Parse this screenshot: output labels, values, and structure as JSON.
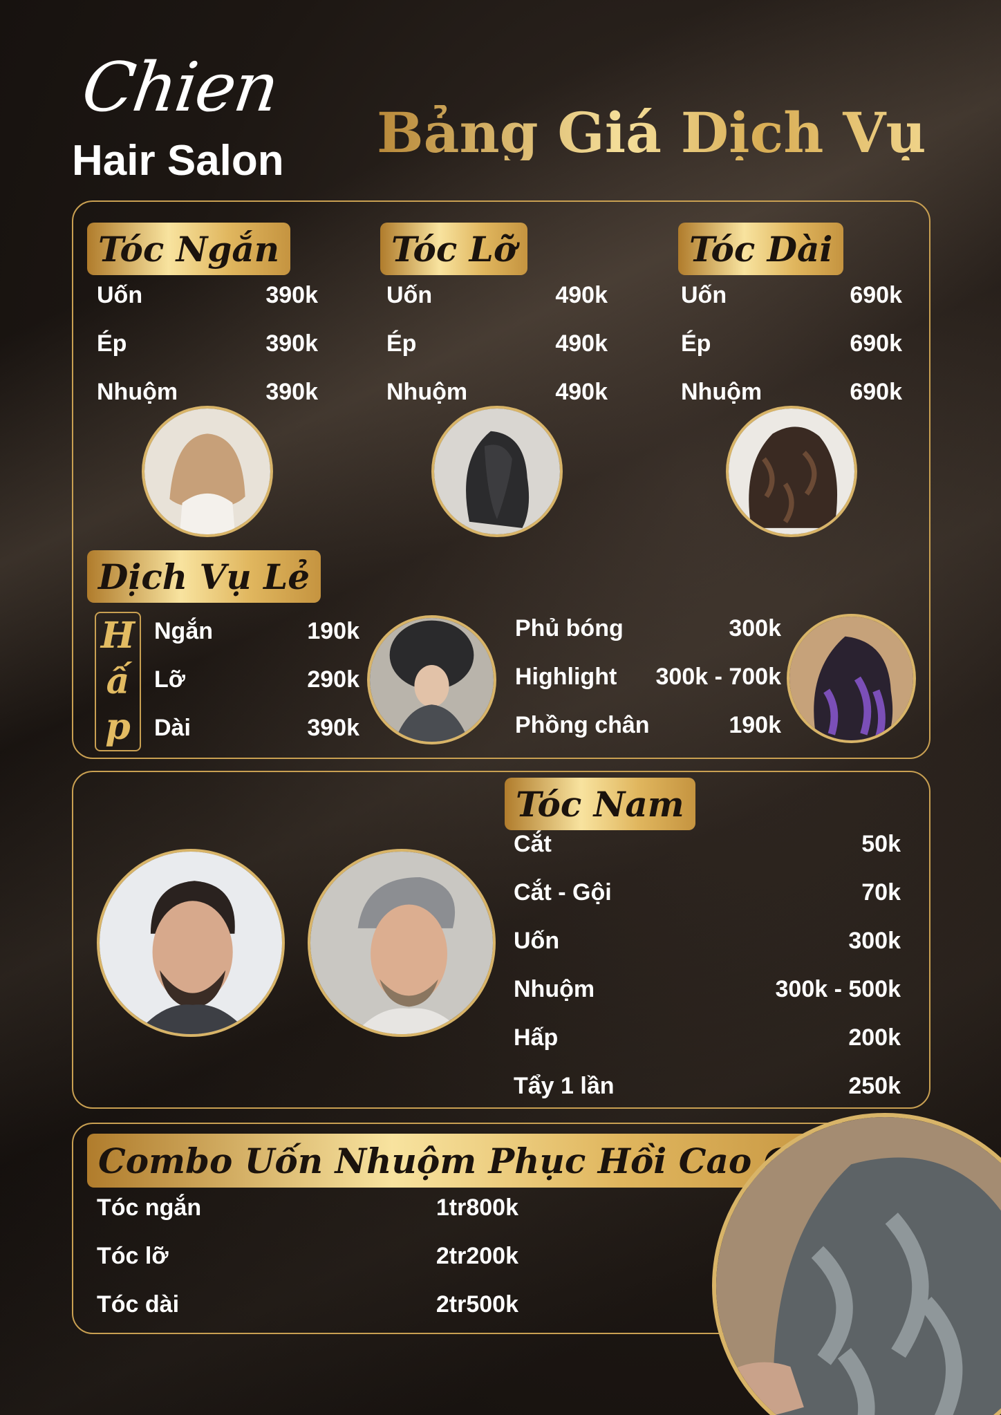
{
  "brand": {
    "script": "Chien",
    "sub": "Hair Salon"
  },
  "title": "Bảng Giá Dịch Vụ",
  "colors": {
    "gold": "#c9a052",
    "background": "#1a1410",
    "text": "#ffffff"
  },
  "short_hair": {
    "title": "Tóc Ngắn",
    "items": [
      {
        "name": "Uốn",
        "price": "390k"
      },
      {
        "name": "Ép",
        "price": "390k"
      },
      {
        "name": "Nhuộm",
        "price": "390k"
      }
    ]
  },
  "medium_hair": {
    "title": "Tóc Lỡ",
    "items": [
      {
        "name": "Uốn",
        "price": "490k"
      },
      {
        "name": "Ép",
        "price": "490k"
      },
      {
        "name": "Nhuộm",
        "price": "490k"
      }
    ]
  },
  "long_hair": {
    "title": "Tóc Dài",
    "items": [
      {
        "name": "Uốn",
        "price": "690k"
      },
      {
        "name": "Ép",
        "price": "690k"
      },
      {
        "name": "Nhuộm",
        "price": "690k"
      }
    ]
  },
  "extras": {
    "title": "Dịch Vụ Lẻ",
    "hap_letters": [
      "H",
      "ấ",
      "p"
    ],
    "hap_items": [
      {
        "name": "Ngắn",
        "price": "190k"
      },
      {
        "name": "Lỡ",
        "price": "290k"
      },
      {
        "name": "Dài",
        "price": "390k"
      }
    ],
    "other_items": [
      {
        "name": "Phủ bóng",
        "price": "300k"
      },
      {
        "name": "Highlight",
        "price": "300k - 700k"
      },
      {
        "name": "Phồng chân",
        "price": "190k"
      }
    ]
  },
  "mens": {
    "title": "Tóc Nam",
    "items": [
      {
        "name": "Cắt",
        "price": "50k"
      },
      {
        "name": "Cắt - Gội",
        "price": "70k"
      },
      {
        "name": "Uốn",
        "price": "300k"
      },
      {
        "name": "Nhuộm",
        "price": "300k - 500k"
      },
      {
        "name": "Hấp",
        "price": "200k"
      },
      {
        "name": "Tẩy 1 lần",
        "price": "250k"
      }
    ]
  },
  "combo": {
    "title": "Combo Uốn Nhuộm Phục Hồi Cao Cấp",
    "items": [
      {
        "name": "Tóc ngắn",
        "price": "1tr800k"
      },
      {
        "name": "Tóc lỡ",
        "price": "2tr200k"
      },
      {
        "name": "Tóc dài",
        "price": "2tr500k"
      }
    ]
  }
}
